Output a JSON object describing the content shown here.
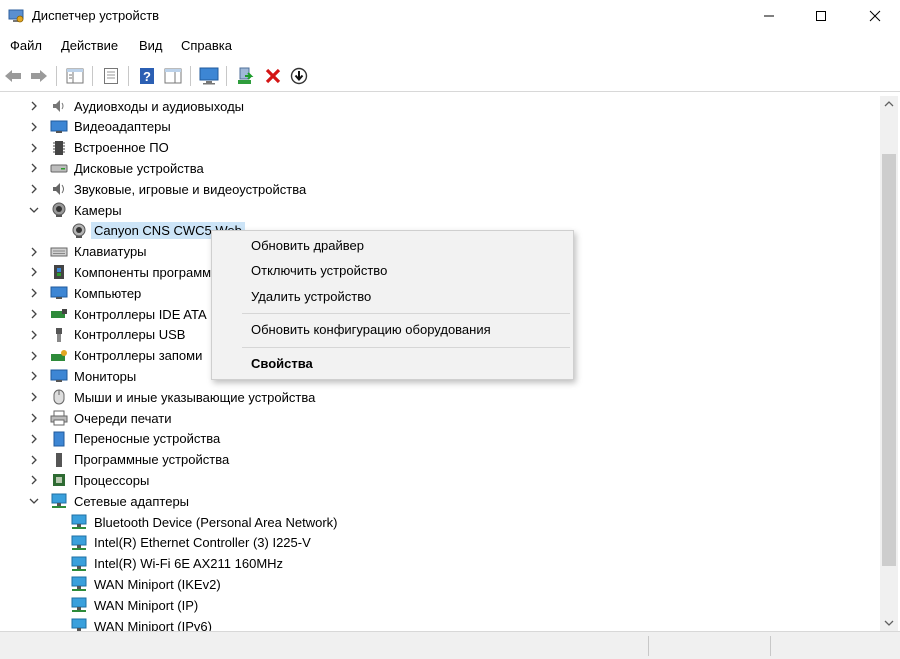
{
  "window": {
    "title": "Диспетчер устройств"
  },
  "menu": [
    "Файл",
    "Действие",
    "Вид",
    "Справка"
  ],
  "tree": {
    "categories": [
      {
        "label": "Аудиовходы и аудиовыходы",
        "icon": "speaker-icon"
      },
      {
        "label": "Видеоадаптеры",
        "icon": "display-adapter-icon"
      },
      {
        "label": "Встроенное ПО",
        "icon": "firmware-icon"
      },
      {
        "label": "Дисковые устройства",
        "icon": "disk-drive-icon"
      },
      {
        "label": "Звуковые, игровые и видеоустройства",
        "icon": "sound-icon"
      },
      {
        "label": "Камеры",
        "icon": "camera-icon",
        "expanded": true
      },
      {
        "label": "Canyon CNS CWC5 Web",
        "icon": "webcam-icon",
        "child": true,
        "selected": true
      },
      {
        "label": "Клавиатуры",
        "icon": "keyboard-icon"
      },
      {
        "label": "Компоненты программ",
        "icon": "software-component-icon"
      },
      {
        "label": "Компьютер",
        "icon": "computer-icon"
      },
      {
        "label": "Контроллеры IDE ATA",
        "icon": "ide-controller-icon"
      },
      {
        "label": "Контроллеры USB",
        "icon": "usb-icon"
      },
      {
        "label": "Контроллеры запоми",
        "icon": "storage-controller-icon"
      },
      {
        "label": "Мониторы",
        "icon": "monitor-icon"
      },
      {
        "label": "Мыши и иные указывающие устройства",
        "icon": "mouse-icon"
      },
      {
        "label": "Очереди печати",
        "icon": "printer-icon"
      },
      {
        "label": "Переносные устройства",
        "icon": "portable-device-icon"
      },
      {
        "label": "Программные устройства",
        "icon": "software-device-icon"
      },
      {
        "label": "Процессоры",
        "icon": "cpu-icon"
      },
      {
        "label": "Сетевые адаптеры",
        "icon": "network-adapter-icon",
        "expanded": true
      },
      {
        "label": "Bluetooth Device (Personal Area Network)",
        "icon": "network-adapter-icon",
        "child": true
      },
      {
        "label": "Intel(R) Ethernet Controller (3) I225-V",
        "icon": "network-adapter-icon",
        "child": true
      },
      {
        "label": "Intel(R) Wi-Fi 6E AX211 160MHz",
        "icon": "network-adapter-icon",
        "child": true
      },
      {
        "label": "WAN Miniport (IKEv2)",
        "icon": "network-adapter-icon",
        "child": true
      },
      {
        "label": "WAN Miniport (IP)",
        "icon": "network-adapter-icon",
        "child": true
      },
      {
        "label": "WAN Miniport (IPv6)",
        "icon": "network-adapter-icon",
        "child": true
      }
    ]
  },
  "context_menu": {
    "items": [
      {
        "label": "Обновить драйвер"
      },
      {
        "label": "Отключить устройство"
      },
      {
        "label": "Удалить устройство"
      },
      {
        "label": "Обновить конфигурацию оборудования"
      },
      {
        "label": "Свойства",
        "bold": true
      }
    ]
  },
  "colors": {
    "selection": "#cce4f7",
    "menu_bg": "#f2f2f2",
    "accent_blue": "#2b6cc4",
    "delete_red": "#d41515"
  }
}
